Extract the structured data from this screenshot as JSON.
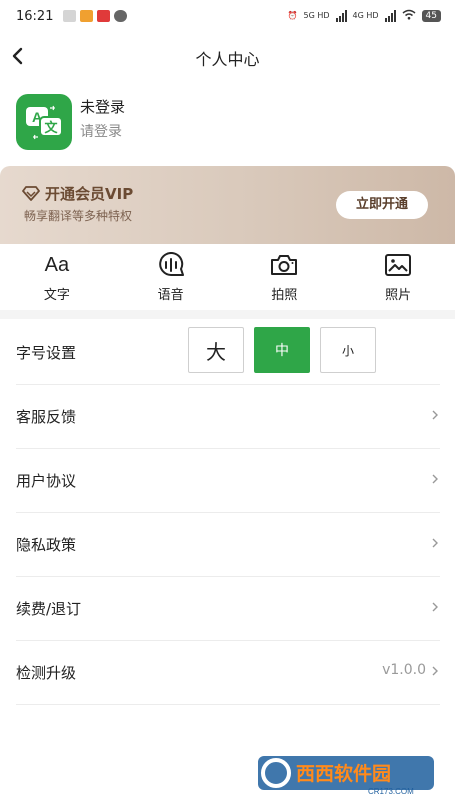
{
  "status_bar": {
    "time": "16:21",
    "network_1": "5G HD",
    "network_2": "4G HD",
    "battery": "45"
  },
  "header": {
    "title": "个人中心",
    "back_icon": "chevron-left-icon"
  },
  "profile": {
    "name": "未登录",
    "login_prompt": "请登录",
    "logo_text_a": "A",
    "logo_text_zh": "文"
  },
  "vip_banner": {
    "title": "开通会员VIP",
    "subtitle": "畅享翻译等多种特权",
    "button_label": "立即开通",
    "icon": "diamond-icon"
  },
  "features": [
    {
      "label": "文字",
      "icon": "text-aa-icon",
      "glyph": "Aa"
    },
    {
      "label": "语音",
      "icon": "voice-icon"
    },
    {
      "label": "拍照",
      "icon": "camera-icon"
    },
    {
      "label": "照片",
      "icon": "photo-icon"
    }
  ],
  "settings": {
    "font_size": {
      "label": "字号设置",
      "options": [
        "大",
        "中",
        "小"
      ],
      "selected": "中"
    },
    "items": [
      {
        "label": "客服反馈"
      },
      {
        "label": "用户协议"
      },
      {
        "label": "隐私政策"
      },
      {
        "label": "续费/退订"
      },
      {
        "label": "检测升级",
        "value": "v1.0.0"
      }
    ]
  },
  "watermark": {
    "brand": "西西软件园",
    "url": "CR173.COM"
  },
  "colors": {
    "accent_green": "#2fa648",
    "vip_brown": "#6b4b33",
    "banner_bg": "#dccbbd"
  }
}
